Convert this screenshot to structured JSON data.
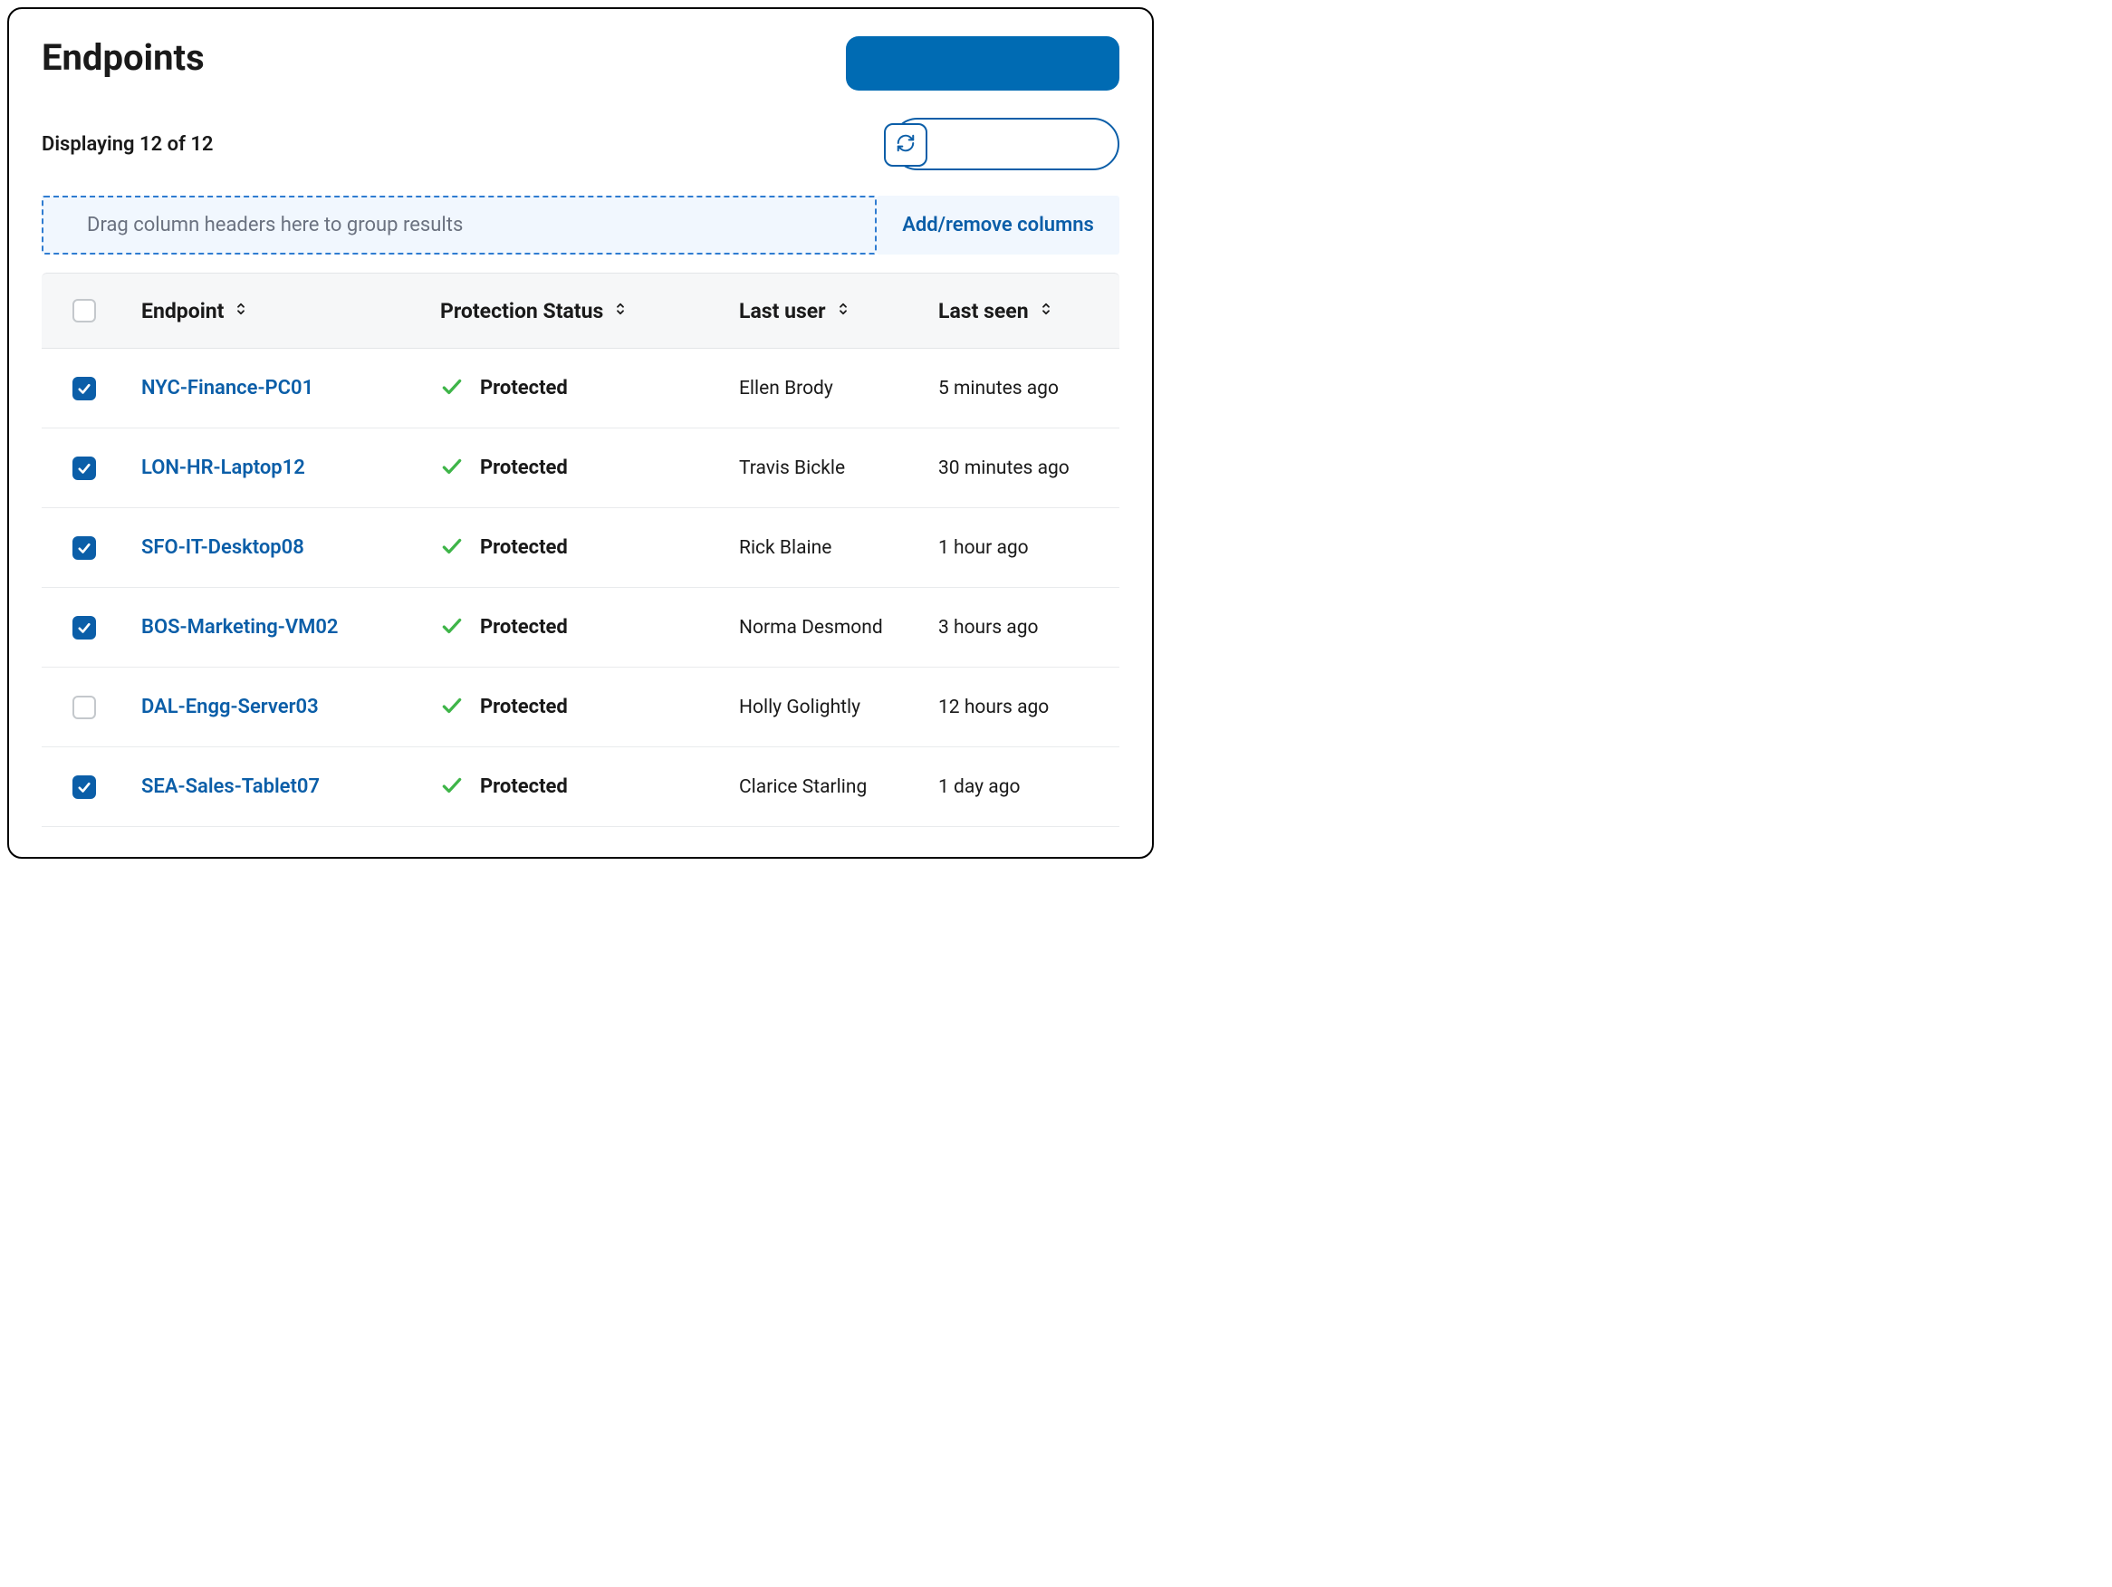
{
  "page_title": "Endpoints",
  "count_text": "Displaying 12 of 12",
  "group_hint": "Drag column headers here to group results",
  "columns_btn": "Add/remove columns",
  "columns": {
    "endpoint": "Endpoint",
    "status": "Protection Status",
    "user": "Last user",
    "seen": "Last seen"
  },
  "rows": [
    {
      "checked": true,
      "endpoint": "NYC-Finance-PC01",
      "status": "Protected",
      "user": "Ellen Brody",
      "seen": "5 minutes ago"
    },
    {
      "checked": true,
      "endpoint": "LON-HR-Laptop12",
      "status": "Protected",
      "user": "Travis Bickle",
      "seen": "30 minutes ago"
    },
    {
      "checked": true,
      "endpoint": "SFO-IT-Desktop08",
      "status": "Protected",
      "user": "Rick Blaine",
      "seen": "1 hour ago"
    },
    {
      "checked": true,
      "endpoint": "BOS-Marketing-VM02",
      "status": "Protected",
      "user": "Norma Desmond",
      "seen": "3 hours ago"
    },
    {
      "checked": false,
      "endpoint": "DAL-Engg-Server03",
      "status": "Protected",
      "user": "Holly Golightly",
      "seen": "12 hours ago"
    },
    {
      "checked": true,
      "endpoint": "SEA-Sales-Tablet07",
      "status": "Protected",
      "user": "Clarice Starling",
      "seen": "1 day ago"
    }
  ]
}
